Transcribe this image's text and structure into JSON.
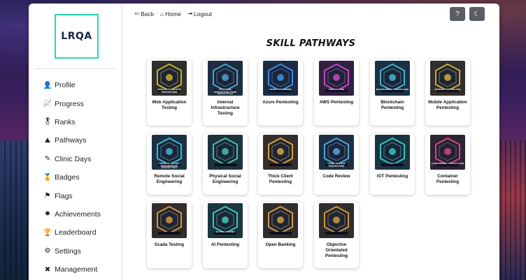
{
  "brand": {
    "logo_text": "LRQA",
    "accent": "#2bd9b0"
  },
  "topnav": [
    {
      "label": "Back",
      "icon": "arrow-left-icon"
    },
    {
      "label": "Home",
      "icon": "home-icon"
    },
    {
      "label": "Logout",
      "icon": "logout-icon"
    }
  ],
  "header_buttons": [
    {
      "icon": "help-icon",
      "glyph": "?"
    },
    {
      "icon": "moon-icon",
      "glyph": "☾"
    }
  ],
  "sidebar": {
    "items": [
      {
        "label": "Profile",
        "icon": "user-icon",
        "glyph": "👤"
      },
      {
        "label": "Progress",
        "icon": "chart-icon",
        "glyph": "📈"
      },
      {
        "label": "Ranks",
        "icon": "medal-icon",
        "glyph": "🎖"
      },
      {
        "label": "Pathways",
        "icon": "road-icon",
        "glyph": "⛰"
      },
      {
        "label": "Clinic Days",
        "icon": "syringe-icon",
        "glyph": "✎"
      },
      {
        "label": "Badges",
        "icon": "badge-icon",
        "glyph": "🏅"
      },
      {
        "label": "Flags",
        "icon": "flag-icon",
        "glyph": "⚑"
      },
      {
        "label": "Achievements",
        "icon": "gear-badge-icon",
        "glyph": "✹"
      },
      {
        "label": "Leaderboard",
        "icon": "trophy-icon",
        "glyph": "🏆"
      },
      {
        "label": "Settings",
        "icon": "gear-icon",
        "glyph": "⚙"
      },
      {
        "label": "Management",
        "icon": "tools-icon",
        "glyph": "✖"
      }
    ]
  },
  "main": {
    "title": "SKILL PATHWAYS",
    "cards": [
      {
        "title": "Web Application Testing",
        "thumb_caption": "WEB APPLICATION PENTESTING",
        "color": "#c9b02c"
      },
      {
        "title": "Internal Infrastructure Testing",
        "thumb_caption": "INTERNAL INFRASTRUCTURE PENTESTING",
        "color": "#4ea3c9"
      },
      {
        "title": "Azure Pentesting",
        "thumb_caption": "Azure PenTesting",
        "color": "#3a8fe0"
      },
      {
        "title": "AWS Pentesting",
        "thumb_caption": "PENTESTING",
        "color": "#c34ac0"
      },
      {
        "title": "Blockchain Pentesting",
        "thumb_caption": "BLOCKCHAIN PENTESTING",
        "color": "#3fb7d1"
      },
      {
        "title": "Mobile Application Pentesting",
        "thumb_caption": "MOBILE PENTESTING",
        "color": "#d2a93a"
      },
      {
        "title": "Remote Social Engineering",
        "thumb_caption": "REMOTE SOCIAL ENGINEERING PENTESTING",
        "color": "#3bb9d6"
      },
      {
        "title": "Physical Social Engineering",
        "thumb_caption": "",
        "color": "#49c0a8"
      },
      {
        "title": "Thick Client Pentesting",
        "thumb_caption": "",
        "color": "#d7a23f"
      },
      {
        "title": "Code Review",
        "thumb_caption": "CODE REVIEW PENTESTING",
        "color": "#4fa7d8"
      },
      {
        "title": "IOT Pentesting",
        "thumb_caption": "IOT",
        "color": "#2ec6c2"
      },
      {
        "title": "Container Pentesting",
        "thumb_caption": "CONTAINERS PENTESTING",
        "color": "#d04b7a"
      },
      {
        "title": "Scada Testing",
        "thumb_caption": "",
        "color": "#d7953a"
      },
      {
        "title": "AI Pentesting",
        "thumb_caption": "AI PENTESTING",
        "color": "#3ccdb0"
      },
      {
        "title": "Open Banking",
        "thumb_caption": "",
        "color": "#d89a45"
      },
      {
        "title": "Objective Orientated Pentesting",
        "thumb_caption": "",
        "color": "#cf9a3a"
      }
    ]
  }
}
